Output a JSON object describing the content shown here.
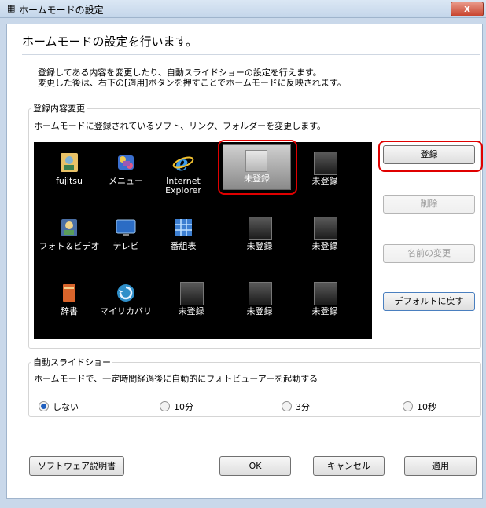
{
  "window": {
    "title": "ホームモードの設定",
    "close_glyph": "x"
  },
  "heading": "ホームモードの設定を行います。",
  "intro": [
    "登録してある内容を変更したり、自動スライドショーの設定を行えます。",
    "変更した後は、右下の[適用]ボタンを押すことでホームモードに反映されます。"
  ],
  "registration": {
    "label": "登録内容変更",
    "description": "ホームモードに登録されているソフト、リンク、フォルダーを変更します。",
    "tiles": [
      {
        "label": "fujitsu",
        "icon": "person-folder-icon"
      },
      {
        "label": "メニュー",
        "icon": "menu-icon"
      },
      {
        "label": "Internet\nExplorer",
        "icon": "ie-icon"
      },
      {
        "label": "未登録",
        "icon": "empty-slot-icon",
        "selected": true
      },
      {
        "label": "未登録",
        "icon": "empty-slot-icon"
      },
      {
        "label": "フォト＆ビデオ",
        "icon": "photo-video-icon"
      },
      {
        "label": "テレビ",
        "icon": "tv-icon"
      },
      {
        "label": "番組表",
        "icon": "program-guide-icon"
      },
      {
        "label": "未登録",
        "icon": "empty-slot-icon"
      },
      {
        "label": "未登録",
        "icon": "empty-slot-icon"
      },
      {
        "label": "辞書",
        "icon": "dictionary-icon"
      },
      {
        "label": "マイリカバリ",
        "icon": "recovery-icon"
      },
      {
        "label": "未登録",
        "icon": "empty-slot-icon"
      },
      {
        "label": "未登録",
        "icon": "empty-slot-icon"
      },
      {
        "label": "未登録",
        "icon": "empty-slot-icon"
      }
    ],
    "buttons": {
      "register": "登録",
      "delete": "削除",
      "rename": "名前の変更",
      "default": "デフォルトに戻す"
    }
  },
  "slideshow": {
    "label": "自動スライドショー",
    "description": "ホームモードで、一定時間経過後に自動的にフォトビューアーを起動する",
    "options": [
      "しない",
      "10分",
      "3分",
      "10秒"
    ],
    "selected": "しない"
  },
  "footer": {
    "manual": "ソフトウェア説明書",
    "ok": "OK",
    "cancel": "キャンセル",
    "apply": "適用"
  },
  "colors": {
    "highlight": "#e00000",
    "grid_bg": "#000000"
  }
}
